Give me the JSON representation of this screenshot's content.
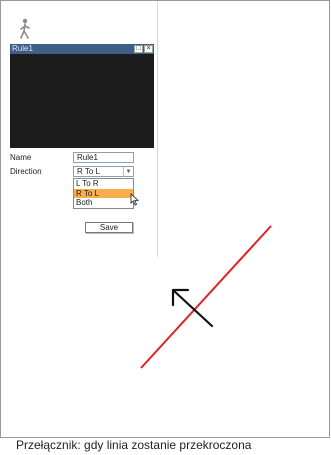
{
  "rule_panel": {
    "title": "Rule1",
    "search_icon": "search-icon",
    "close_icon": "close-icon"
  },
  "form": {
    "name_label": "Name",
    "name_value": "Rule1",
    "direction_label": "Direction",
    "direction_value": "R To L",
    "direction_options": [
      "L To R",
      "R To L",
      "Both"
    ],
    "selected_option": "R To L",
    "save_label": "Save"
  },
  "colors": {
    "line": "#e51e25",
    "arrow": "#111111",
    "highlight": "#f6ad4d",
    "titlebar": "#3d5e86"
  },
  "caption": "Przełącznik: gdy linia zostanie przekroczona"
}
